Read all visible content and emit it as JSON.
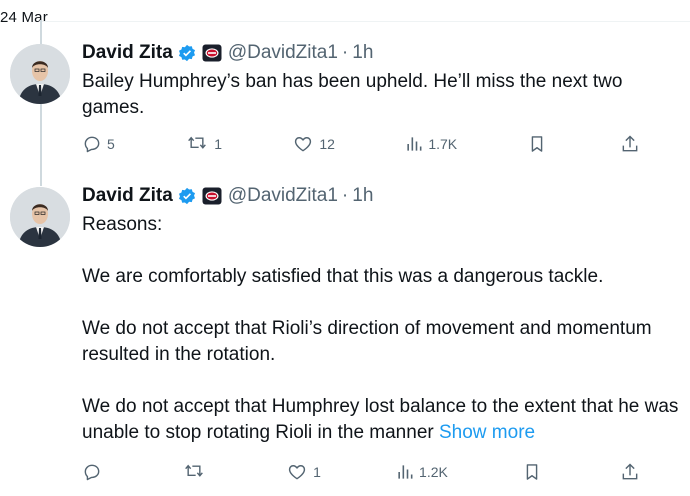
{
  "date_label": "24 Mar",
  "colors": {
    "text": "#0f1419",
    "secondary": "#536471",
    "link": "#1d9bf0",
    "verified": "#1d9bf0",
    "org_badge": "#c8102e"
  },
  "tweets": [
    {
      "author": {
        "name": "David Zita",
        "handle": "@DavidZita1",
        "time": "1h"
      },
      "body": [
        "Bailey Humphrey’s ban has been upheld. He’ll miss the next two games."
      ],
      "show_more": "",
      "actions": {
        "reply": "5",
        "retweet": "1",
        "like": "12",
        "views": "1.7K"
      }
    },
    {
      "author": {
        "name": "David Zita",
        "handle": "@DavidZita1",
        "time": "1h"
      },
      "body": [
        "Reasons:",
        "We are comfortably satisfied that this was a dangerous tackle.",
        "We do not accept that Rioli’s direction of movement and momentum resulted in the rotation.",
        "We do not accept that Humphrey lost balance to the extent that he was unable to stop rotating Rioli in the manner"
      ],
      "show_more": "Show more",
      "actions": {
        "reply": "",
        "retweet": "",
        "like": "1",
        "views": "1.2K"
      }
    }
  ],
  "separator": "·"
}
